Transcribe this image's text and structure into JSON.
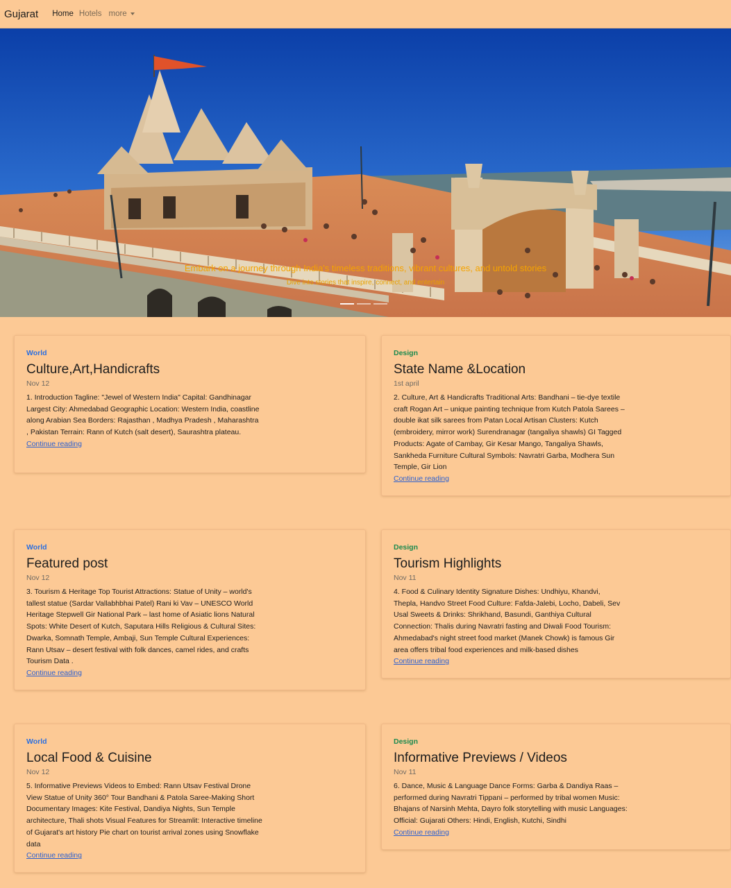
{
  "navbar": {
    "brand": "Gujarat",
    "links": [
      "Home",
      "Hotels",
      "more"
    ]
  },
  "hero": {
    "headline": "Embark on a journey through India's timeless traditions, vibrant cultures, and untold stories",
    "subline": "Dive into stories that inspire, connect, and entertain"
  },
  "colors": {
    "background": "#fcc995",
    "world_category": "#2b6fe0",
    "design_category": "#1c8a4f",
    "link": "#2b5fd0"
  },
  "cards": [
    {
      "category": "World",
      "title": "Culture,Art,Handicrafts",
      "date": "Nov 12",
      "text": "1. Introduction Tagline: \"Jewel of Western India\" Capital: Gandhinagar Largest City: Ahmedabad Geographic Location: Western India, coastline along Arabian Sea Borders: Rajasthan , Madhya Pradesh , Maharashtra , Pakistan Terrain: Rann of Kutch (salt desert), Saurashtra plateau.",
      "link": "Continue reading"
    },
    {
      "category": "Design",
      "title": "State Name &Location",
      "date": "1st april",
      "text": "2. Culture, Art & Handicrafts Traditional Arts: Bandhani – tie-dye textile craft Rogan Art – unique painting technique from Kutch Patola Sarees – double ikat silk sarees from Patan Local Artisan Clusters: Kutch (embroidery, mirror work) Surendranagar (tangaliya shawls) GI Tagged Products: Agate of Cambay, Gir Kesar Mango, Tangaliya Shawls, Sankheda Furniture Cultural Symbols: Navratri Garba, Modhera Sun Temple, Gir Lion",
      "link": "Continue reading"
    },
    {
      "category": "World",
      "title": "Featured post",
      "date": "Nov 12",
      "text": "3. Tourism & Heritage Top Tourist Attractions: Statue of Unity – world's tallest statue (Sardar Vallabhbhai Patel) Rani ki Vav – UNESCO World Heritage Stepwell Gir National Park – last home of Asiatic lions Natural Spots: White Desert of Kutch, Saputara Hills Religious & Cultural Sites: Dwarka, Somnath Temple, Ambaji, Sun Temple Cultural Experiences: Rann Utsav – desert festival with folk dances, camel rides, and crafts Tourism Data .",
      "link": "Continue reading"
    },
    {
      "category": "Design",
      "title": "Tourism Highlights",
      "date": "Nov 11",
      "text": "4. Food & Culinary Identity Signature Dishes: Undhiyu, Khandvi, Thepla, Handvo Street Food Culture: Fafda-Jalebi, Locho, Dabeli, Sev Usal Sweets & Drinks: Shrikhand, Basundi, Ganthiya Cultural Connection: Thalis during Navratri fasting and Diwali Food Tourism: Ahmedabad's night street food market (Manek Chowk) is famous Gir area offers tribal food experiences and milk-based dishes",
      "link": "Continue reading"
    },
    {
      "category": "World",
      "title": "Local Food & Cuisine",
      "date": "Nov 12",
      "text": "5. Informative Previews Videos to Embed: Rann Utsav Festival Drone View Statue of Unity 360° Tour Bandhani & Patola Saree-Making Short Documentary Images: Kite Festival, Dandiya Nights, Sun Temple architecture, Thali shots Visual Features for Streamlit: Interactive timeline of Gujarat's art history Pie chart on tourist arrival zones using Snowflake data",
      "link": "Continue reading"
    },
    {
      "category": "Design",
      "title": "Informative Previews / Videos",
      "date": "Nov 11",
      "text": "6. Dance, Music & Language Dance Forms: Garba & Dandiya Raas – performed during Navratri Tippani – performed by tribal women Music: Bhajans of Narsinh Mehta, Dayro folk storytelling with music Languages: Official: Gujarati Others: Hindi, English, Kutchi, Sindhi",
      "link": "Continue reading"
    }
  ]
}
